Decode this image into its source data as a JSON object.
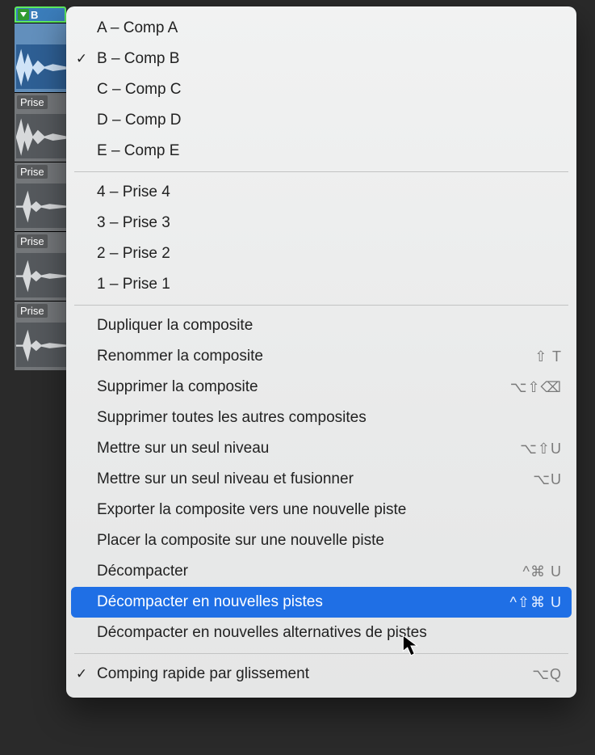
{
  "header": {
    "label": "B"
  },
  "lanes": [
    {
      "label": "",
      "selected": true
    },
    {
      "label": "Prise",
      "selected": false
    },
    {
      "label": "Prise",
      "selected": false
    },
    {
      "label": "Prise",
      "selected": false
    },
    {
      "label": "Prise",
      "selected": false
    }
  ],
  "menu": {
    "groups": [
      {
        "items": [
          {
            "label": "A – Comp A",
            "checked": false,
            "shortcut": ""
          },
          {
            "label": "B – Comp B",
            "checked": true,
            "shortcut": ""
          },
          {
            "label": "C – Comp C",
            "checked": false,
            "shortcut": ""
          },
          {
            "label": "D – Comp D",
            "checked": false,
            "shortcut": ""
          },
          {
            "label": "E – Comp E",
            "checked": false,
            "shortcut": ""
          }
        ]
      },
      {
        "items": [
          {
            "label": "4 – Prise 4",
            "checked": false,
            "shortcut": ""
          },
          {
            "label": "3 – Prise 3",
            "checked": false,
            "shortcut": ""
          },
          {
            "label": "2 – Prise 2",
            "checked": false,
            "shortcut": ""
          },
          {
            "label": "1 – Prise 1",
            "checked": false,
            "shortcut": ""
          }
        ]
      },
      {
        "items": [
          {
            "label": "Dupliquer la composite",
            "checked": false,
            "shortcut": ""
          },
          {
            "label": "Renommer la composite",
            "checked": false,
            "shortcut": "⇧ T"
          },
          {
            "label": "Supprimer la composite",
            "checked": false,
            "shortcut": "⌥⇧⌫"
          },
          {
            "label": "Supprimer toutes les autres composites",
            "checked": false,
            "shortcut": ""
          },
          {
            "label": "Mettre sur un seul niveau",
            "checked": false,
            "shortcut": "⌥⇧U"
          },
          {
            "label": "Mettre sur un seul niveau et fusionner",
            "checked": false,
            "shortcut": "⌥U"
          },
          {
            "label": "Exporter la composite vers une nouvelle piste",
            "checked": false,
            "shortcut": ""
          },
          {
            "label": "Placer la composite sur une nouvelle piste",
            "checked": false,
            "shortcut": ""
          },
          {
            "label": "Décompacter",
            "checked": false,
            "shortcut": "^⌘ U"
          },
          {
            "label": "Décompacter en nouvelles pistes",
            "checked": false,
            "shortcut": "^⇧⌘ U",
            "highlight": true
          },
          {
            "label": "Décompacter en nouvelles alternatives de pistes",
            "checked": false,
            "shortcut": ""
          }
        ]
      },
      {
        "items": [
          {
            "label": "Comping rapide par glissement",
            "checked": true,
            "shortcut": "⌥Q"
          }
        ]
      }
    ]
  }
}
